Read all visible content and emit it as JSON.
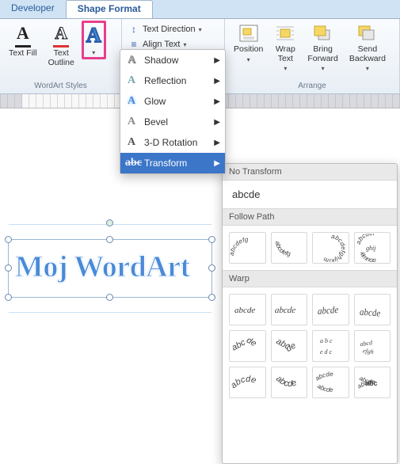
{
  "tabs": {
    "developer": "Developer",
    "shapeFormat": "Shape Format"
  },
  "ribbon": {
    "wordartStyles": {
      "label": "WordArt Styles",
      "textFill": "Text Fill",
      "textOutline": "Text\nOutline",
      "textEffects": "Text Effects"
    },
    "textOptions": {
      "textDirection": "Text Direction",
      "alignText": "Align Text"
    },
    "arrange": {
      "label": "Arrange",
      "position": "Position",
      "wrapText": "Wrap\nText",
      "bringForward": "Bring\nForward",
      "sendBackward": "Send\nBackward"
    }
  },
  "dropdown": {
    "shadow": "Shadow",
    "reflection": "Reflection",
    "glow": "Glow",
    "bevel": "Bevel",
    "rotation3d": "3-D Rotation",
    "transform": "Transform"
  },
  "gallery": {
    "noTransform": "No Transform",
    "abcde": "abcde",
    "followPath": "Follow Path",
    "warp": "Warp"
  },
  "document": {
    "wordart": "Moj WordArt"
  }
}
